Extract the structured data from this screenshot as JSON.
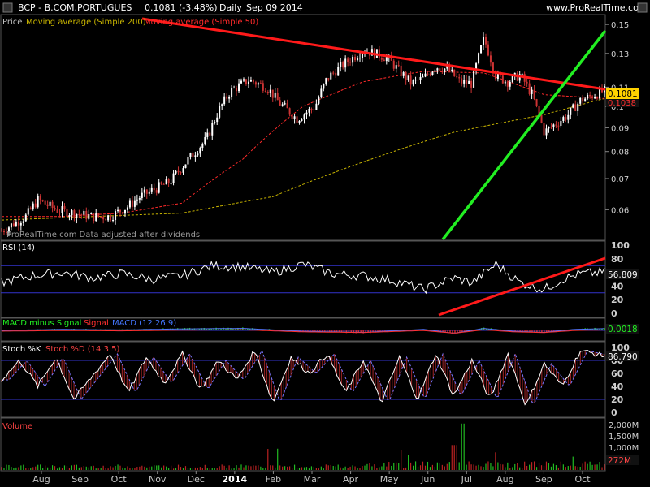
{
  "header": {
    "symbol": "BCP - B.COM.PORTUGUES",
    "quote": "0.1081 (-3.48%)",
    "period": "Daily",
    "date": "Sep 09 2014",
    "site": "www.ProRealTime.com"
  },
  "colors": {
    "background": "#000000",
    "bull_candle": "#ffffff",
    "bear_candle": "#cc3333",
    "ma200": "#c8b400",
    "ma50": "#ff2a2a",
    "trend_red": "#ff1a1a",
    "trend_green": "#22ee22",
    "band_line": "#3333cc",
    "panel_border": "#555555"
  },
  "chart_data": [
    {
      "panel": "price",
      "type": "line",
      "legend": [
        "Price",
        "Moving average (Simple 200)",
        "Moving average (Simple 50)"
      ],
      "watermark": "ProRealTime.com  Data adjusted after dividends",
      "price_ticks": [
        "0.15",
        "0.13",
        "0.11",
        "0.1",
        "0.09",
        "0.08",
        "0.07",
        "0.06"
      ],
      "price_tick_values": [
        0.15,
        0.13,
        0.11,
        0.1,
        0.09,
        0.08,
        0.07,
        0.06
      ],
      "y_range": [
        0.052,
        0.155
      ],
      "y_scale": "log",
      "last_price_label": "0.1081",
      "ma_label": "0.1038",
      "close_series_t": [
        0,
        0.02,
        0.04,
        0.06,
        0.09,
        0.12,
        0.15,
        0.18,
        0.21,
        0.23,
        0.26,
        0.28,
        0.31,
        0.34,
        0.36,
        0.38,
        0.41,
        0.44,
        0.46,
        0.49,
        0.52,
        0.54,
        0.57,
        0.6,
        0.62,
        0.64,
        0.66,
        0.68,
        0.7,
        0.72,
        0.74,
        0.76,
        0.78,
        0.8,
        0.82,
        0.84,
        0.86,
        0.88,
        0.9,
        0.92,
        0.94,
        0.96,
        1.0
      ],
      "close_series": [
        0.054,
        0.056,
        0.058,
        0.063,
        0.06,
        0.059,
        0.058,
        0.058,
        0.061,
        0.064,
        0.067,
        0.069,
        0.077,
        0.085,
        0.098,
        0.108,
        0.114,
        0.11,
        0.102,
        0.094,
        0.1,
        0.115,
        0.124,
        0.132,
        0.13,
        0.127,
        0.119,
        0.112,
        0.115,
        0.122,
        0.12,
        0.113,
        0.112,
        0.14,
        0.116,
        0.113,
        0.117,
        0.106,
        0.088,
        0.092,
        0.096,
        0.103,
        0.108
      ],
      "ma50_t": [
        0,
        0.1,
        0.2,
        0.3,
        0.4,
        0.5,
        0.6,
        0.7,
        0.8,
        0.9,
        1.0
      ],
      "ma50": [
        0.058,
        0.058,
        0.059,
        0.062,
        0.077,
        0.1,
        0.113,
        0.119,
        0.118,
        0.106,
        0.104
      ],
      "ma200_t": [
        0,
        0.15,
        0.3,
        0.45,
        0.6,
        0.75,
        0.9,
        1.0
      ],
      "ma200": [
        0.057,
        0.058,
        0.059,
        0.064,
        0.076,
        0.088,
        0.096,
        0.104
      ]
    },
    {
      "panel": "rsi",
      "type": "line",
      "title": "RSI (14)",
      "ticks": [
        "100",
        "80",
        "60",
        "40",
        "20",
        "0"
      ],
      "tick_values": [
        100,
        80,
        60,
        40,
        20,
        0
      ],
      "y_range": [
        0,
        100
      ],
      "bands": [
        70,
        30
      ],
      "last_label": "56.809",
      "t": [
        0,
        0.05,
        0.1,
        0.15,
        0.2,
        0.25,
        0.3,
        0.35,
        0.4,
        0.45,
        0.5,
        0.55,
        0.6,
        0.65,
        0.7,
        0.75,
        0.78,
        0.82,
        0.86,
        0.9,
        0.93,
        0.96,
        1.0
      ],
      "values": [
        45,
        55,
        60,
        52,
        58,
        50,
        55,
        70,
        68,
        60,
        72,
        58,
        55,
        48,
        35,
        52,
        45,
        72,
        45,
        35,
        50,
        58,
        60
      ]
    },
    {
      "panel": "macd",
      "type": "area",
      "title": "MACD minus Signal",
      "series_names": [
        "Signal",
        "MACD (12 26 9)"
      ],
      "last_label": "0.0018",
      "t": [
        0,
        0.1,
        0.2,
        0.3,
        0.4,
        0.5,
        0.6,
        0.7,
        0.75,
        0.8,
        0.85,
        0.9,
        0.95,
        1.0
      ],
      "values": [
        0.0,
        0.001,
        0.0005,
        0.0015,
        0.002,
        -0.001,
        -0.002,
        0.001,
        -0.003,
        0.002,
        -0.001,
        -0.002,
        0.001,
        0.0018
      ]
    },
    {
      "panel": "stoch",
      "type": "line",
      "title": "Stoch %K",
      "series_names": [
        "Stoch %D (14 3 5)"
      ],
      "ticks": [
        "100",
        "80",
        "60",
        "40",
        "20",
        "0"
      ],
      "tick_values": [
        100,
        80,
        60,
        40,
        20,
        0
      ],
      "y_range": [
        0,
        100
      ],
      "bands": [
        80,
        20
      ],
      "last_label": "86.790",
      "k_t": [
        0,
        0.03,
        0.06,
        0.09,
        0.12,
        0.15,
        0.18,
        0.21,
        0.24,
        0.27,
        0.3,
        0.33,
        0.36,
        0.39,
        0.42,
        0.45,
        0.48,
        0.51,
        0.54,
        0.57,
        0.6,
        0.63,
        0.66,
        0.69,
        0.72,
        0.75,
        0.78,
        0.81,
        0.84,
        0.87,
        0.9,
        0.93,
        0.96,
        1.0
      ],
      "k_values": [
        50,
        80,
        40,
        85,
        20,
        55,
        90,
        30,
        85,
        45,
        90,
        35,
        80,
        50,
        95,
        15,
        85,
        60,
        90,
        30,
        80,
        15,
        85,
        20,
        90,
        25,
        80,
        20,
        90,
        10,
        75,
        40,
        95,
        87
      ]
    },
    {
      "panel": "volume",
      "type": "bar",
      "title": "Volume",
      "ticks": [
        "2,000M",
        "1,500M",
        "1,000M",
        "500M"
      ],
      "tick_values": [
        2000,
        1500,
        1000,
        500
      ],
      "y_range": [
        0,
        2150
      ],
      "last_label": "272M",
      "months": [
        "Aug",
        "Sep",
        "Oct",
        "Nov",
        "Dec",
        "2014",
        "Feb",
        "Mar",
        "Apr",
        "May",
        "Jun",
        "Jul",
        "Aug",
        "Sep",
        "Oct"
      ]
    }
  ]
}
